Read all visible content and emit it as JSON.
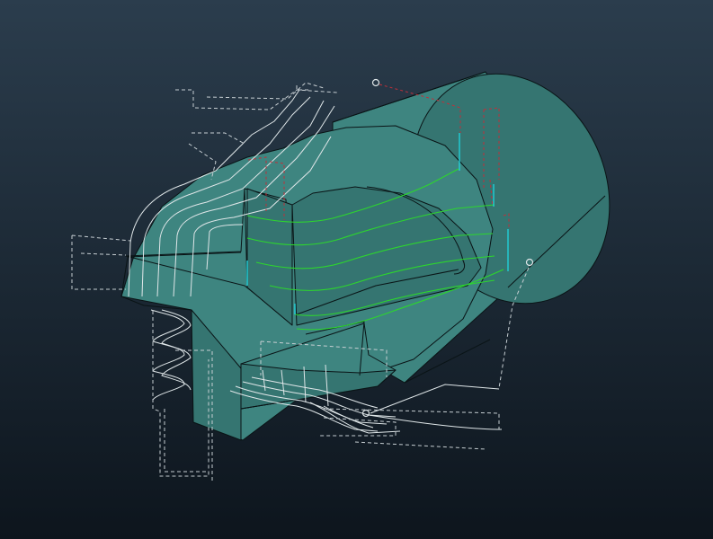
{
  "viewport": {
    "background_top": "#2b3d4d",
    "background_bottom": "#0d151d"
  },
  "model": {
    "name": "turned-part-solid",
    "face_color": "#3e8580",
    "face_shade_color": "#357571",
    "edge_color": "#0a1416"
  },
  "toolpaths": {
    "finish_pass_color": "#2dd62d",
    "lead_in_color": "#1fd6e0",
    "rapid_color": "#c0303a",
    "roughing_pass_color": "#dfe6e8",
    "clearance_color": "#c6ced2",
    "finish_pass_count": 5
  },
  "markers": [
    {
      "name": "start-point-marker"
    },
    {
      "name": "end-point-marker"
    },
    {
      "name": "clearance-point-marker"
    }
  ]
}
